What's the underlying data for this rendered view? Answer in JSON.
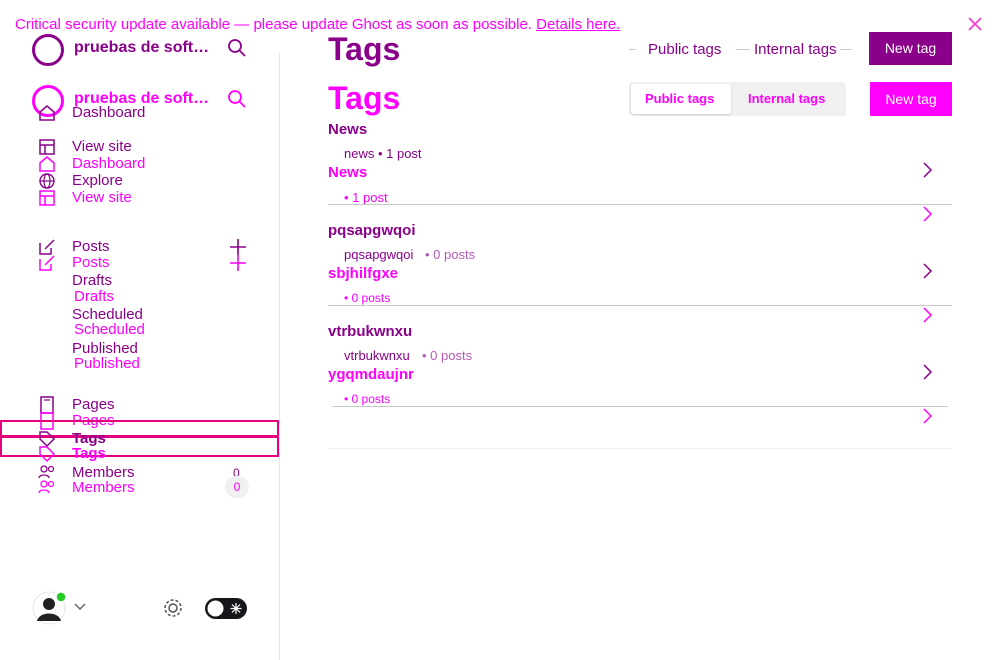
{
  "banner": {
    "text": "Critical security update available — please update Ghost as soon as possible.",
    "link": "Details here."
  },
  "sidebar": {
    "site_name": "pruebas de soft…",
    "site_name_overlay": "pruebas de soft…",
    "nav": {
      "dashboard": "Dashboard",
      "view_site": "View site",
      "dashboard_overlay": "Dashboard",
      "explore": "Explore",
      "view_site_overlay": "View site",
      "posts": "Posts",
      "posts_overlay": "Posts",
      "drafts": "Drafts",
      "drafts_overlay": "Drafts",
      "scheduled": "Scheduled",
      "scheduled_overlay": "Scheduled",
      "published": "Published",
      "published_overlay": "Published",
      "pages": "Pages",
      "pages_overlay": "Pages",
      "tags": "Tags",
      "tags_overlay": "Tags",
      "members": "Members",
      "members_overlay": "Members",
      "members_count": "0",
      "members_count_overlay": "0"
    }
  },
  "main": {
    "title": "Tags",
    "title_overlay": "Tags",
    "tabs": {
      "public": "Public tags",
      "internal": "Internal tags",
      "public_overlay": "Public tags",
      "internal_overlay": "Internal tags"
    },
    "new_tag": "New tag",
    "new_tag_overlay": "New tag",
    "tags": [
      {
        "name": "News",
        "meta": "news • 1 post",
        "overlay_name": "News",
        "overlay_meta": "• 1 post"
      },
      {
        "name": "pqsapgwqoi",
        "slug": "pqsapgwqoi",
        "posts": "• 0 posts",
        "overlay_name": "sbjhilfgxe",
        "overlay_meta": "• 0 posts"
      },
      {
        "name": "vtrbukwnxu",
        "slug": "vtrbukwnxu",
        "posts": "• 0 posts",
        "overlay_name": "ygqmdaujnr",
        "overlay_meta": "• 0 posts"
      }
    ]
  },
  "colors": {
    "purple": "#8a008a",
    "pink": "#ff00ff",
    "online": "#22cc22"
  }
}
